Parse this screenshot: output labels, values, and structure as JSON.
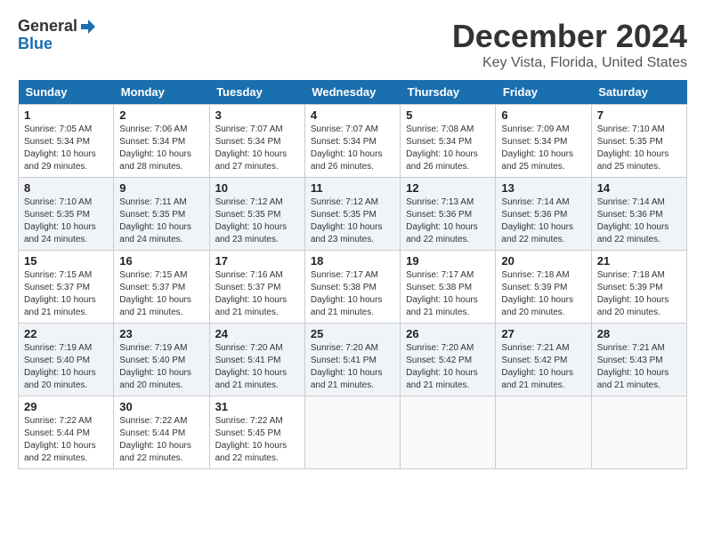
{
  "header": {
    "logo_general": "General",
    "logo_blue": "Blue",
    "month_title": "December 2024",
    "location": "Key Vista, Florida, United States"
  },
  "days_of_week": [
    "Sunday",
    "Monday",
    "Tuesday",
    "Wednesday",
    "Thursday",
    "Friday",
    "Saturday"
  ],
  "weeks": [
    [
      {
        "day": "1",
        "sunrise": "7:05 AM",
        "sunset": "5:34 PM",
        "daylight": "10 hours and 29 minutes."
      },
      {
        "day": "2",
        "sunrise": "7:06 AM",
        "sunset": "5:34 PM",
        "daylight": "10 hours and 28 minutes."
      },
      {
        "day": "3",
        "sunrise": "7:07 AM",
        "sunset": "5:34 PM",
        "daylight": "10 hours and 27 minutes."
      },
      {
        "day": "4",
        "sunrise": "7:07 AM",
        "sunset": "5:34 PM",
        "daylight": "10 hours and 26 minutes."
      },
      {
        "day": "5",
        "sunrise": "7:08 AM",
        "sunset": "5:34 PM",
        "daylight": "10 hours and 26 minutes."
      },
      {
        "day": "6",
        "sunrise": "7:09 AM",
        "sunset": "5:34 PM",
        "daylight": "10 hours and 25 minutes."
      },
      {
        "day": "7",
        "sunrise": "7:10 AM",
        "sunset": "5:35 PM",
        "daylight": "10 hours and 25 minutes."
      }
    ],
    [
      {
        "day": "8",
        "sunrise": "7:10 AM",
        "sunset": "5:35 PM",
        "daylight": "10 hours and 24 minutes."
      },
      {
        "day": "9",
        "sunrise": "7:11 AM",
        "sunset": "5:35 PM",
        "daylight": "10 hours and 24 minutes."
      },
      {
        "day": "10",
        "sunrise": "7:12 AM",
        "sunset": "5:35 PM",
        "daylight": "10 hours and 23 minutes."
      },
      {
        "day": "11",
        "sunrise": "7:12 AM",
        "sunset": "5:35 PM",
        "daylight": "10 hours and 23 minutes."
      },
      {
        "day": "12",
        "sunrise": "7:13 AM",
        "sunset": "5:36 PM",
        "daylight": "10 hours and 22 minutes."
      },
      {
        "day": "13",
        "sunrise": "7:14 AM",
        "sunset": "5:36 PM",
        "daylight": "10 hours and 22 minutes."
      },
      {
        "day": "14",
        "sunrise": "7:14 AM",
        "sunset": "5:36 PM",
        "daylight": "10 hours and 22 minutes."
      }
    ],
    [
      {
        "day": "15",
        "sunrise": "7:15 AM",
        "sunset": "5:37 PM",
        "daylight": "10 hours and 21 minutes."
      },
      {
        "day": "16",
        "sunrise": "7:15 AM",
        "sunset": "5:37 PM",
        "daylight": "10 hours and 21 minutes."
      },
      {
        "day": "17",
        "sunrise": "7:16 AM",
        "sunset": "5:37 PM",
        "daylight": "10 hours and 21 minutes."
      },
      {
        "day": "18",
        "sunrise": "7:17 AM",
        "sunset": "5:38 PM",
        "daylight": "10 hours and 21 minutes."
      },
      {
        "day": "19",
        "sunrise": "7:17 AM",
        "sunset": "5:38 PM",
        "daylight": "10 hours and 21 minutes."
      },
      {
        "day": "20",
        "sunrise": "7:18 AM",
        "sunset": "5:39 PM",
        "daylight": "10 hours and 20 minutes."
      },
      {
        "day": "21",
        "sunrise": "7:18 AM",
        "sunset": "5:39 PM",
        "daylight": "10 hours and 20 minutes."
      }
    ],
    [
      {
        "day": "22",
        "sunrise": "7:19 AM",
        "sunset": "5:40 PM",
        "daylight": "10 hours and 20 minutes."
      },
      {
        "day": "23",
        "sunrise": "7:19 AM",
        "sunset": "5:40 PM",
        "daylight": "10 hours and 20 minutes."
      },
      {
        "day": "24",
        "sunrise": "7:20 AM",
        "sunset": "5:41 PM",
        "daylight": "10 hours and 21 minutes."
      },
      {
        "day": "25",
        "sunrise": "7:20 AM",
        "sunset": "5:41 PM",
        "daylight": "10 hours and 21 minutes."
      },
      {
        "day": "26",
        "sunrise": "7:20 AM",
        "sunset": "5:42 PM",
        "daylight": "10 hours and 21 minutes."
      },
      {
        "day": "27",
        "sunrise": "7:21 AM",
        "sunset": "5:42 PM",
        "daylight": "10 hours and 21 minutes."
      },
      {
        "day": "28",
        "sunrise": "7:21 AM",
        "sunset": "5:43 PM",
        "daylight": "10 hours and 21 minutes."
      }
    ],
    [
      {
        "day": "29",
        "sunrise": "7:22 AM",
        "sunset": "5:44 PM",
        "daylight": "10 hours and 22 minutes."
      },
      {
        "day": "30",
        "sunrise": "7:22 AM",
        "sunset": "5:44 PM",
        "daylight": "10 hours and 22 minutes."
      },
      {
        "day": "31",
        "sunrise": "7:22 AM",
        "sunset": "5:45 PM",
        "daylight": "10 hours and 22 minutes."
      },
      null,
      null,
      null,
      null
    ]
  ]
}
